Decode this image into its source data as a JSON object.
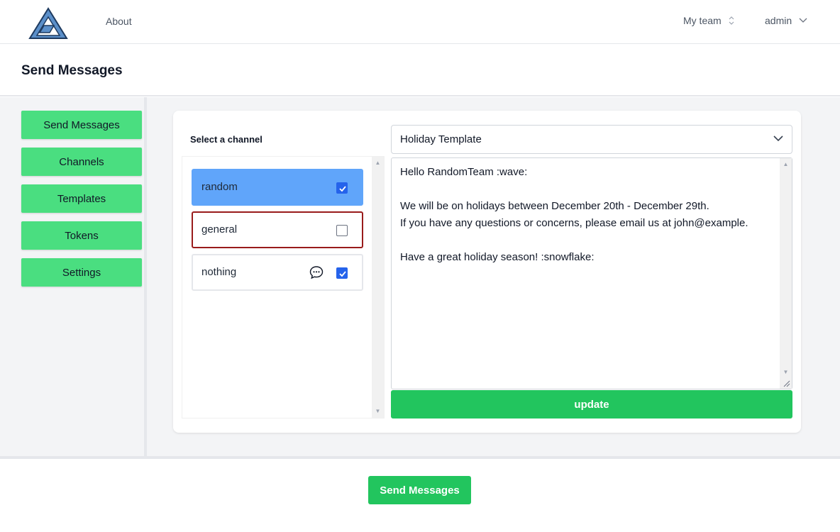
{
  "nav": {
    "about": "About",
    "team": "My team",
    "user": "admin"
  },
  "header": {
    "title": "Send Messages"
  },
  "sidebar": {
    "items": [
      {
        "label": "Send Messages"
      },
      {
        "label": "Channels"
      },
      {
        "label": "Templates"
      },
      {
        "label": "Tokens"
      },
      {
        "label": "Settings"
      }
    ]
  },
  "channels": {
    "label": "Select a channel",
    "items": [
      {
        "name": "random",
        "checked": true,
        "state": "selected"
      },
      {
        "name": "general",
        "checked": false,
        "state": "error"
      },
      {
        "name": "nothing",
        "checked": true,
        "state": "normal",
        "icon": "chat-bubble-icon"
      }
    ]
  },
  "template": {
    "selected": "Holiday Template",
    "lines": [
      "Hello RandomTeam :wave:",
      "",
      "We will be on holidays between December 20th - December 29th.",
      "If you have any questions or concerns, please email us at john@example.",
      "",
      "Have a great holiday season! :snowflake:"
    ],
    "update_label": "update"
  },
  "footer": {
    "send_label": "Send Messages"
  },
  "colors": {
    "accent_green": "#4ade80",
    "button_green": "#22c55e",
    "selected_blue": "#60a5fa",
    "checkbox_blue": "#2563eb",
    "error_red": "#991b1b"
  }
}
